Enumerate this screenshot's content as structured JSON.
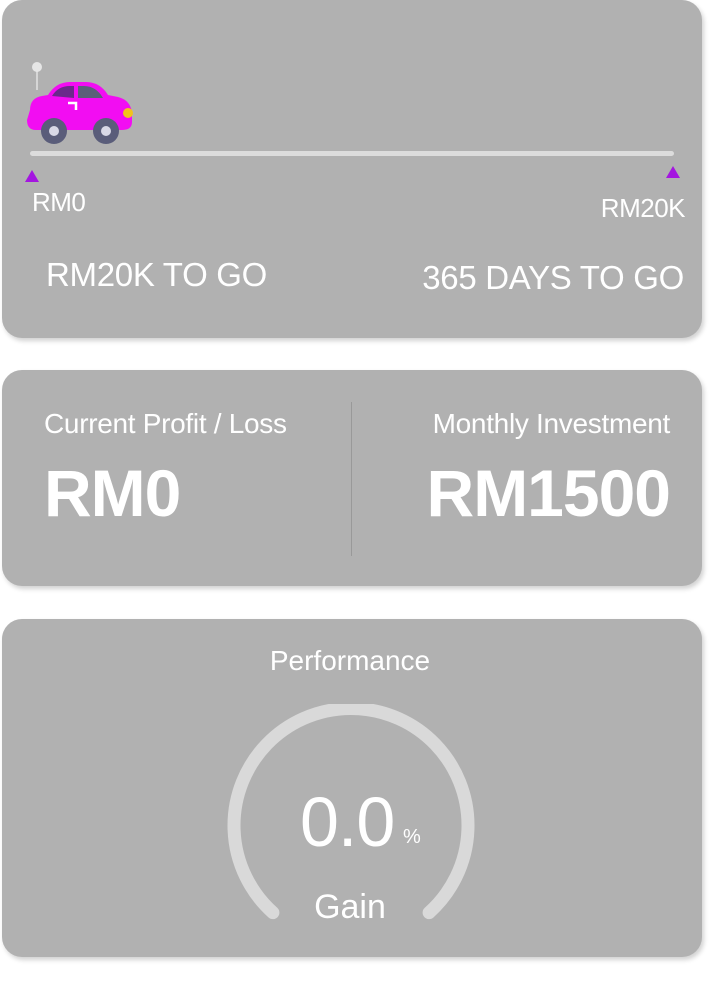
{
  "goal": {
    "start_label": "RM0",
    "end_label": "RM20K",
    "amount_to_go": "RM20K TO GO",
    "days_to_go": "365 DAYS TO GO",
    "progress": 0,
    "icon": "car-icon",
    "marker_color": "#a416e0",
    "car_color": "#f20df2"
  },
  "stats": {
    "profit_caption": "Current Profit / Loss",
    "profit_value": "RM0",
    "investment_caption": "Monthly Investment",
    "investment_value": "RM1500"
  },
  "performance": {
    "title": "Performance",
    "value": "0.0",
    "unit": "%",
    "label": "Gain",
    "gain_percent": 0.0
  },
  "colors": {
    "card_background": "#b1b1b1",
    "track": "#dcdcdc",
    "text": "#ffffff"
  }
}
